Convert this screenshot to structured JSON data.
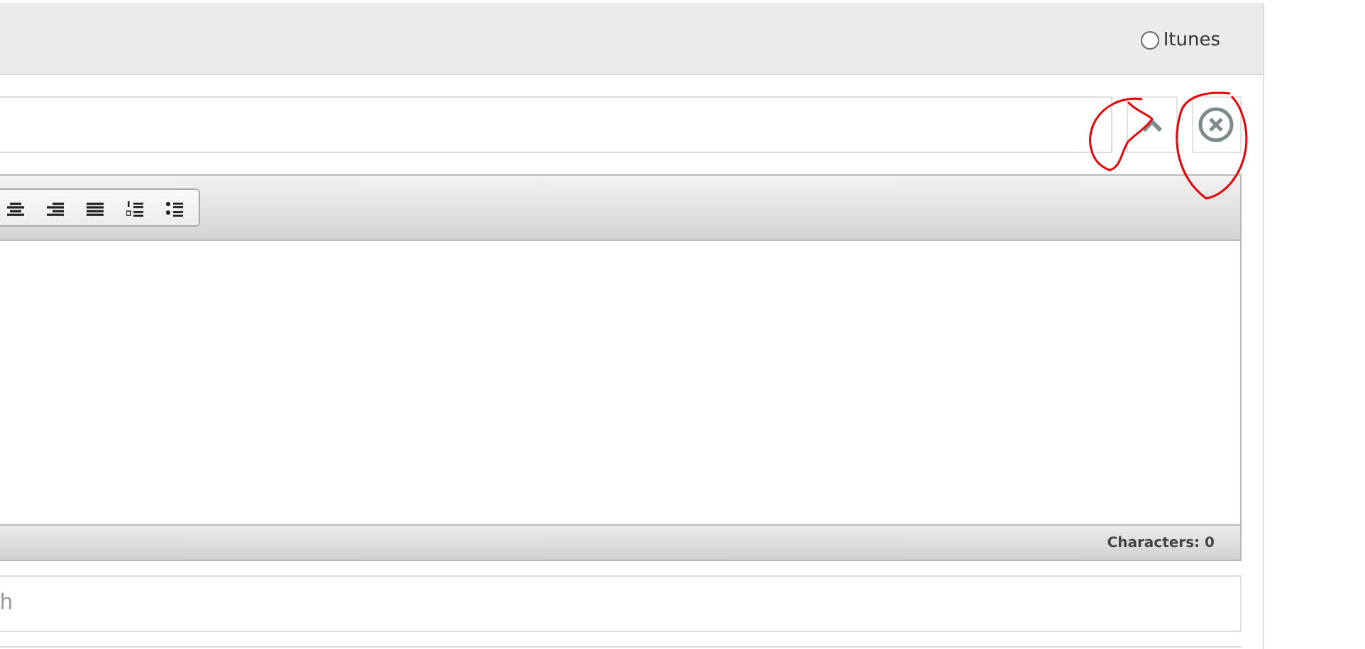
{
  "header": {
    "radio": {
      "label": "Itunes",
      "selected": false
    }
  },
  "buttons": [
    {
      "kind": "collapse"
    },
    {
      "kind": "remove"
    }
  ],
  "toolbar": [
    {
      "kind": "align-center"
    },
    {
      "kind": "align-right"
    },
    {
      "kind": "justify"
    },
    {
      "kind": "ordered-list"
    },
    {
      "kind": "bullet-list"
    }
  ],
  "status_bar": {
    "count": "Characters: 0"
  },
  "second_field": {
    "placeholder": "h"
  }
}
